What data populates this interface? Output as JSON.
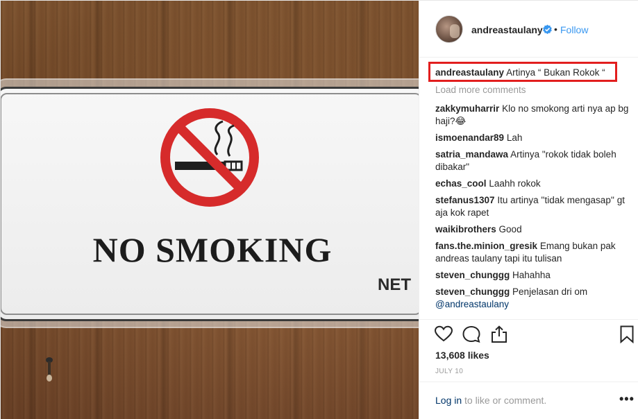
{
  "photo": {
    "sign_text": "NO SMOKING",
    "brand_text": "NET"
  },
  "header": {
    "username": "andreastaulany",
    "separator": "•",
    "follow_label": "Follow"
  },
  "caption": {
    "username": "andreastaulany",
    "text": "Artinya “ Bukan Rokok “"
  },
  "load_more": "Load more comments",
  "comments": [
    {
      "user": "zakkymuharrir",
      "text": "Klo no smokong arti nya ap bg haji?😂"
    },
    {
      "user": "ismoenandar89",
      "text": "Lah"
    },
    {
      "user": "satria_mandawa",
      "text": "Artinya \"rokok tidak boleh dibakar\""
    },
    {
      "user": "echas_cool",
      "text": "Laahh rokok"
    },
    {
      "user": "stefanus1307",
      "text": "Itu artinya ''tidak mengasap'' gt aja kok rapet"
    },
    {
      "user": "waikibrothers",
      "text": "Good"
    },
    {
      "user": "fans.the.minion_gresik",
      "text": "Emang bukan pak andreas taulany tapi itu tulisan"
    },
    {
      "user": "steven_chunggg",
      "text": "Hahahha"
    },
    {
      "user": "steven_chunggg",
      "text": "Penjelasan dri om",
      "mention": "@andreastaulany"
    }
  ],
  "likes": "13,608 likes",
  "date": "JULY 10",
  "footer": {
    "login_link": "Log in",
    "login_rest": " to like or comment."
  },
  "icons": {
    "like": "heart-icon",
    "comment": "speech-bubble-icon",
    "share": "share-icon",
    "save": "bookmark-icon",
    "verified": "verified-badge-icon",
    "more": "ellipsis-icon"
  },
  "colors": {
    "link_blue": "#3897f0",
    "highlight_red": "#e21e1e",
    "muted_gray": "#999999",
    "no_smoking_red": "#d62b2b"
  }
}
